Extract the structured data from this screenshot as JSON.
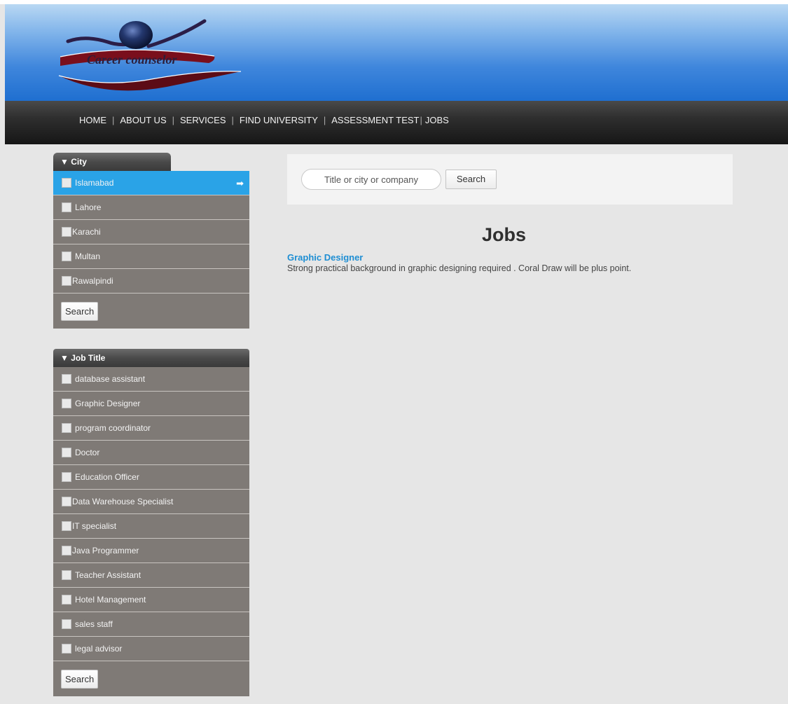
{
  "logo": {
    "text": "Career counselor"
  },
  "nav": {
    "items": [
      "HOME",
      "ABOUT US",
      "SERVICES",
      "FIND UNIVERSITY",
      "ASSESSMENT TEST",
      "JOBS"
    ]
  },
  "city_filter": {
    "title": "▼ City",
    "items": [
      "Islamabad",
      "Lahore",
      "Karachi",
      "Multan",
      "Rawalpindi"
    ],
    "active_item": "Islamabad",
    "search_label": "Search"
  },
  "job_title_filter": {
    "title": "▼ Job Title",
    "items": [
      "database assistant",
      "Graphic Designer",
      "program coordinator",
      "Doctor",
      "Education Officer",
      "Data Warehouse Specialist",
      "IT specialist",
      "Java Programmer",
      "Teacher Assistant",
      "Hotel Management",
      "sales staff",
      "legal advisor"
    ],
    "search_label": "Search"
  },
  "search": {
    "placeholder": "Title or city or company",
    "button_label": "Search"
  },
  "main": {
    "title": "Jobs",
    "jobs": [
      {
        "title": "Graphic Designer",
        "description": "Strong practical background in graphic designing required . Coral Draw will be plus point."
      }
    ]
  }
}
